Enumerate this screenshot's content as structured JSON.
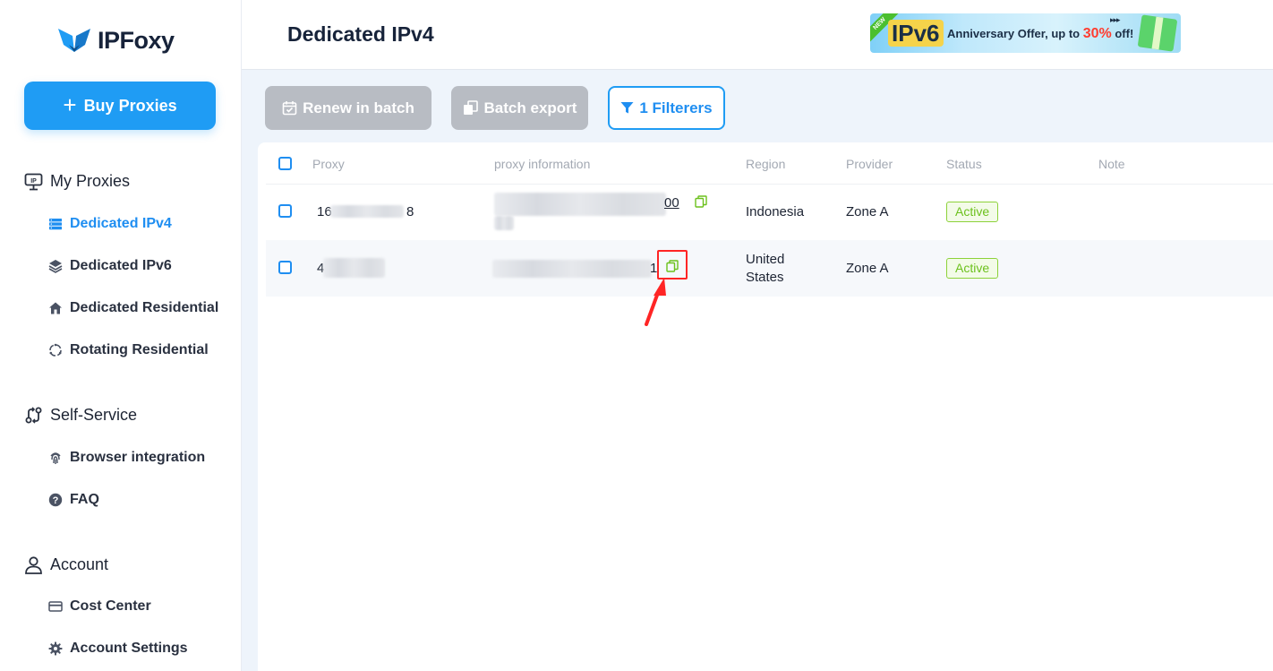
{
  "app": {
    "name": "IPFoxy"
  },
  "sidebar": {
    "buy_button": "Buy Proxies",
    "sections": [
      {
        "title": "My Proxies",
        "icon": "ip-icon"
      },
      {
        "title": "Self-Service",
        "icon": "route-icon"
      },
      {
        "title": "Account",
        "icon": "user-icon"
      }
    ],
    "items": [
      {
        "label": "Dedicated IPv4",
        "icon": "server-icon",
        "active": true
      },
      {
        "label": "Dedicated IPv6",
        "icon": "layers-icon"
      },
      {
        "label": "Dedicated Residential",
        "icon": "home-icon"
      },
      {
        "label": "Rotating Residential",
        "icon": "rotate-icon"
      },
      {
        "label": "Browser integration",
        "icon": "fingerprint-icon"
      },
      {
        "label": "FAQ",
        "icon": "question-icon"
      },
      {
        "label": "Cost Center",
        "icon": "card-icon"
      },
      {
        "label": "Account Settings",
        "icon": "gear-icon"
      }
    ]
  },
  "header": {
    "title": "Dedicated IPv4",
    "banner": {
      "ribbon": "NEW",
      "product": "IPv6",
      "offer_prefix": "Anniversary Offer, up to ",
      "offer_pct": "30%",
      "offer_suffix": " off!",
      "arrows": "▸▸▸"
    }
  },
  "toolbar": {
    "renew_label": "Renew in batch",
    "export_label": "Batch export",
    "filter_label": "1 Filterers"
  },
  "table": {
    "columns": [
      "Proxy",
      "proxy information",
      "Region",
      "Provider",
      "Status",
      "Note"
    ],
    "rows": [
      {
        "proxy_prefix": "16",
        "proxy_suffix": "8",
        "info_suffix": "00",
        "region_line1": "Indonesia",
        "region_line2": "",
        "provider": "Zone A",
        "status": "Active",
        "note": ""
      },
      {
        "proxy_prefix": "4",
        "proxy_suffix": "",
        "info_suffix": "1",
        "region_line1": "United",
        "region_line2": "States",
        "provider": "Zone A",
        "status": "Active",
        "note": ""
      }
    ]
  },
  "colors": {
    "accent": "#1f9cf4",
    "active": "#1f8ef1",
    "status_green": "#6cc11d",
    "annotation_red": "#ff2525",
    "disabled": "#b8bcc3"
  }
}
